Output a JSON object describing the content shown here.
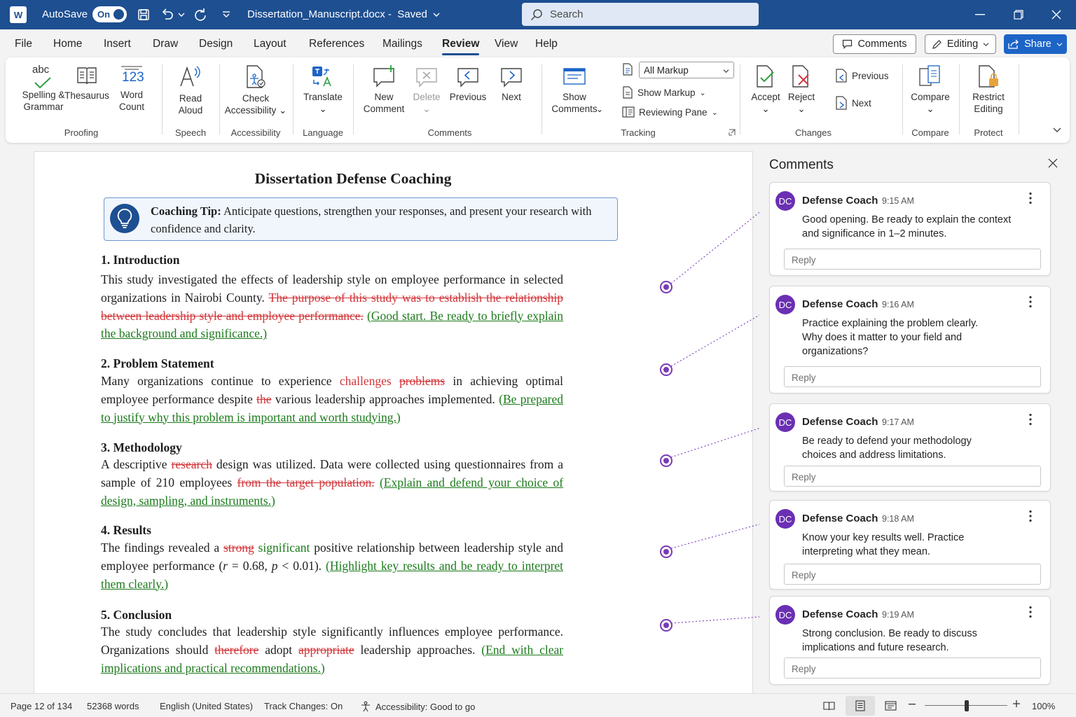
{
  "titlebar": {
    "app_badge": "W",
    "autosave_label": "AutoSave",
    "autosave_state": "On",
    "doc_title": "Dissertation_Manuscript.docx",
    "doc_status": "Saved",
    "search_placeholder": "Search"
  },
  "menu": {
    "items": [
      "File",
      "Home",
      "Insert",
      "Draw",
      "Design",
      "Layout",
      "References",
      "Mailings",
      "Review",
      "View",
      "Help"
    ],
    "active": "Review",
    "comments_label": "Comments",
    "editing_label": "Editing",
    "share_label": "Share"
  },
  "ribbon": {
    "spelling": {
      "icon_text": "abc",
      "label": "Spelling & Grammar"
    },
    "thesaurus": "Thesaurus",
    "word_count": {
      "icon_text": "123",
      "label": "Word Count"
    },
    "read_aloud": "Read Aloud",
    "check_accessibility": "Check Accessibility",
    "translate": "Translate",
    "new_comment": "New Comment",
    "delete": "Delete",
    "previous": "Previous",
    "next": "Next",
    "show_comments": "Show Comments",
    "markup_select": "All Markup",
    "show_markup": "Show Markup",
    "reviewing_pane": "Reviewing Pane",
    "accept": "Accept",
    "reject": "Reject",
    "changes_previous": "Previous",
    "changes_next": "Next",
    "compare": "Compare",
    "restrict_editing": "Restrict Editing",
    "groups": {
      "proofing": "Proofing",
      "speech": "Speech",
      "accessibility": "Accessibility",
      "language": "Language",
      "comments": "Comments",
      "tracking": "Tracking",
      "changes": "Changes",
      "compare": "Compare",
      "protect": "Protect"
    }
  },
  "document": {
    "title": "Dissertation Defense Coaching",
    "tip_label": "Coaching Tip:",
    "tip_text": "Anticipate questions, strengthen your responses, and present your research with confidence and clarity.",
    "sections": [
      {
        "heading": "1.  Introduction",
        "body": "This study investigated the effects of leadership style on employee performance in selected organizations in Nairobi County.",
        "deleted": "The purpose of this study was to establish the relationship between leadership style and employee performance.",
        "inserted": "(Good start. Be ready to briefly explain the background and significance.)"
      },
      {
        "heading": "2.  Problem Statement",
        "body_1": "Many organizations continue to experience",
        "inserted_1": "challenges",
        "deleted_1": "problems",
        "body_2": "in achieving optimal employee performance despite",
        "deleted_2": "the",
        "body_3": "various leadership approaches implemented.",
        "inserted": "(Be prepared to justify why this problem is important and worth studying.)"
      },
      {
        "heading": "3.  Methodology",
        "body_1": "A descriptive",
        "deleted_1": "research",
        "body_2": "design was utilized. Data were collected using questionnaires from a sample of 210 employees",
        "deleted_2": "from the target population.",
        "inserted": "(Explain and defend your choice of design, sampling, and instruments.)"
      },
      {
        "heading": "4.  Results",
        "body_1": "The findings revealed a",
        "deleted_1": "strong",
        "inserted_1": "significant",
        "body_2": "positive relationship between leadership style and employee performance (",
        "stat_r": "r",
        "stat_r_val": " = 0.68, ",
        "stat_p": "p",
        "stat_p_val": " < 0.01).",
        "inserted": "(Highlight key results and be ready to interpret them clearly.)"
      },
      {
        "heading": "5.  Conclusion",
        "body_1": "The study concludes that leadership style significantly influences employee performance. Organizations should",
        "deleted_1": "therefore",
        "body_2": "adopt",
        "deleted_2": "appropriate",
        "body_3": "leadership approaches.",
        "inserted": "(End with clear implications and practical recommendations.)"
      }
    ]
  },
  "comments_pane": {
    "title": "Comments",
    "reply_placeholder": "Reply",
    "comments": [
      {
        "initials": "DC",
        "author": "Defense Coach",
        "time": "9:15 AM",
        "text": "Good opening. Be ready to explain the context and significance in 1–2 minutes."
      },
      {
        "initials": "DC",
        "author": "Defense Coach",
        "time": "9:16 AM",
        "text": "Practice explaining the problem clearly. Why does it matter to your field and organizations?"
      },
      {
        "initials": "DC",
        "author": "Defense Coach",
        "time": "9:17 AM",
        "text": "Be ready to defend your methodology choices and address limitations."
      },
      {
        "initials": "DC",
        "author": "Defense Coach",
        "time": "9:18 AM",
        "text": "Know your key results well. Practice interpreting what they mean."
      },
      {
        "initials": "DC",
        "author": "Defense Coach",
        "time": "9:19 AM",
        "text": "Strong conclusion. Be ready to discuss implications and future research."
      }
    ]
  },
  "statusbar": {
    "page": "Page 12 of 134",
    "words": "52368 words",
    "language": "English (United States)",
    "track_changes": "Track Changes: On",
    "accessibility": "Accessibility: Good to go",
    "zoom": "100%",
    "zoom_level": 1.0
  },
  "colors": {
    "titlebar": "#1d4f91",
    "deleted_text": "#d13438",
    "inserted_text": "#1b7a1b",
    "comment_avatar": "#6a2fb3",
    "share_button": "#1d64c7"
  }
}
